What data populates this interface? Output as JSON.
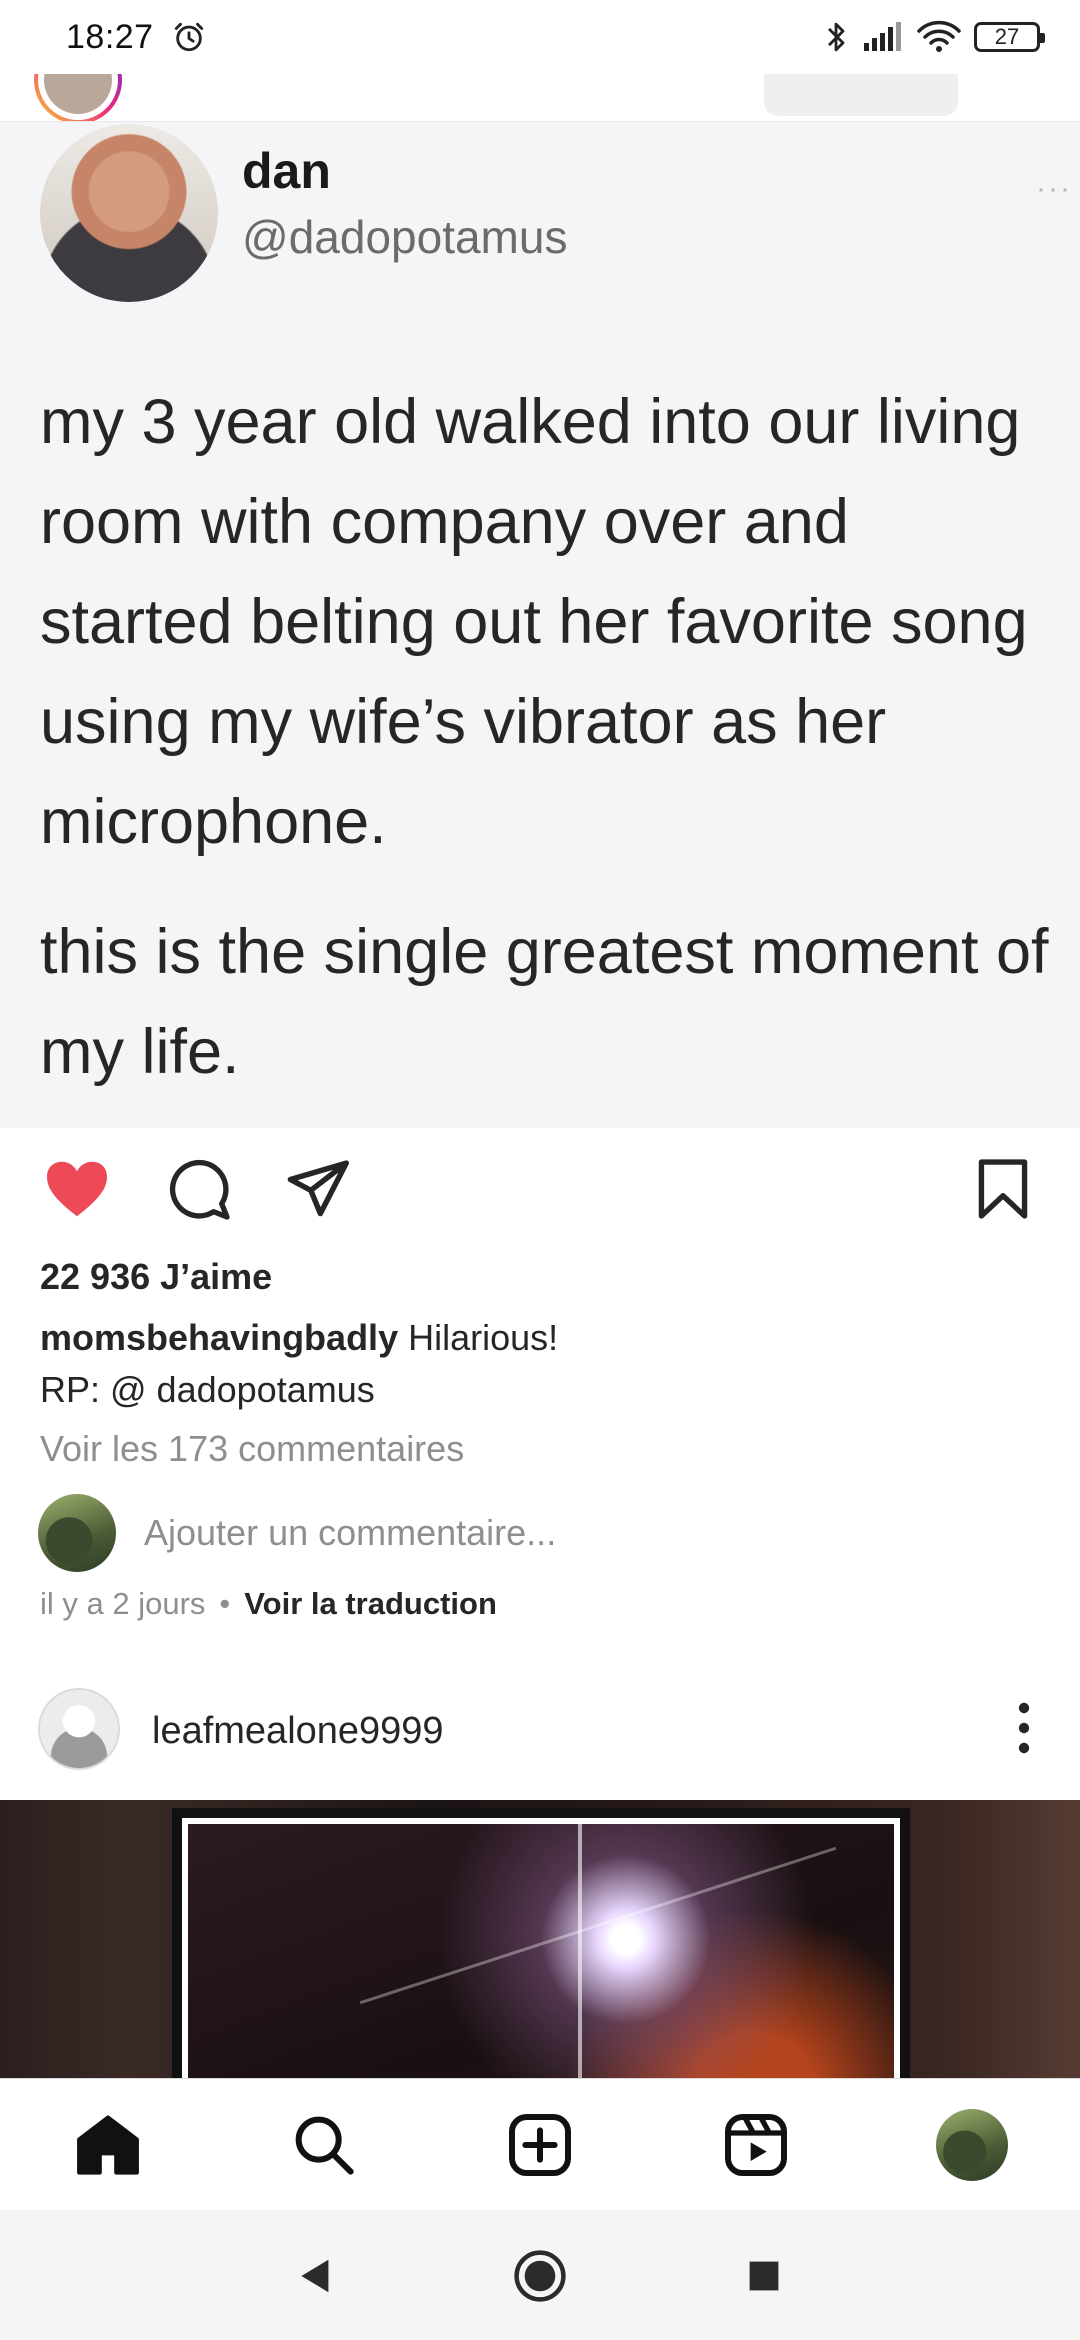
{
  "status_bar": {
    "time": "18:27",
    "battery": "27"
  },
  "tweet": {
    "name": "dan",
    "handle": "@dadopotamus",
    "more": "···",
    "text": "my 3 year old walked into our living room with company over and started belting out her favorite song using my wife’s vibrator as her microphone.",
    "text2": "this is the single greatest moment of my life."
  },
  "post": {
    "likes": "22 936 J’aime",
    "caption_user": "momsbehavingbadly",
    "caption_text": "Hilarious!",
    "caption_line2": "RP: @ dadopotamus",
    "view_comments": "Voir les 173 commentaires",
    "comment_placeholder": "Ajouter un commentaire...",
    "time_ago": "il y a 2 jours",
    "separator": "•",
    "translate": "Voir la traduction",
    "liked": true,
    "like_color": "#ed4956"
  },
  "next_post": {
    "username": "leafmealone9999"
  },
  "icons": {
    "status": [
      "alarm-icon",
      "bluetooth-icon",
      "signal-icon",
      "wifi-icon",
      "battery-icon"
    ],
    "actions": [
      "heart-icon",
      "comment-icon",
      "share-icon",
      "bookmark-icon"
    ],
    "nav": [
      "home-icon",
      "search-icon",
      "create-icon",
      "reels-icon",
      "profile-avatar"
    ],
    "system": [
      "back-icon",
      "home-circle-icon",
      "recents-icon"
    ]
  }
}
